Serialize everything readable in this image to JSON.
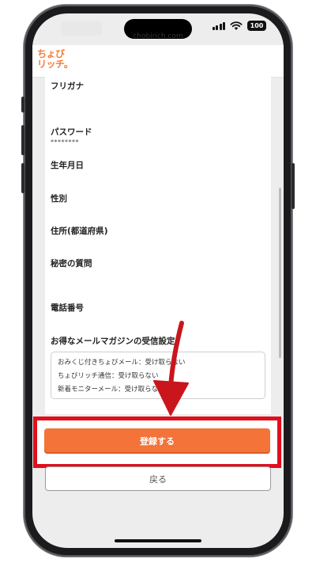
{
  "status_bar": {
    "battery": "100"
  },
  "url": "chobirich.com",
  "header": {
    "logo_line1": "ちょび",
    "logo_line2": "リッチ。"
  },
  "form": {
    "fields": [
      {
        "label": "フリガナ",
        "value": ""
      },
      {
        "label": "パスワード",
        "value": "********"
      },
      {
        "label": "生年月日",
        "value": ""
      },
      {
        "label": "性別",
        "value": ""
      },
      {
        "label": "住所(都道府県)",
        "value": ""
      },
      {
        "label": "秘密の質問",
        "value": ""
      },
      {
        "label": "電話番号",
        "value": ""
      }
    ],
    "newsletter_label": "お得なメールマガジンの受信設定",
    "newsletter_items": [
      "おみくじ付きちょびメール：受け取らない",
      "ちょびリッチ通信：受け取らない",
      "新着モニターメール：受け取らない"
    ]
  },
  "actions": {
    "submit_label": "登録する",
    "back_label": "戻る"
  },
  "colors": {
    "accent": "#f47339",
    "highlight": "#e10f1b",
    "logo": "#f47a3b"
  }
}
